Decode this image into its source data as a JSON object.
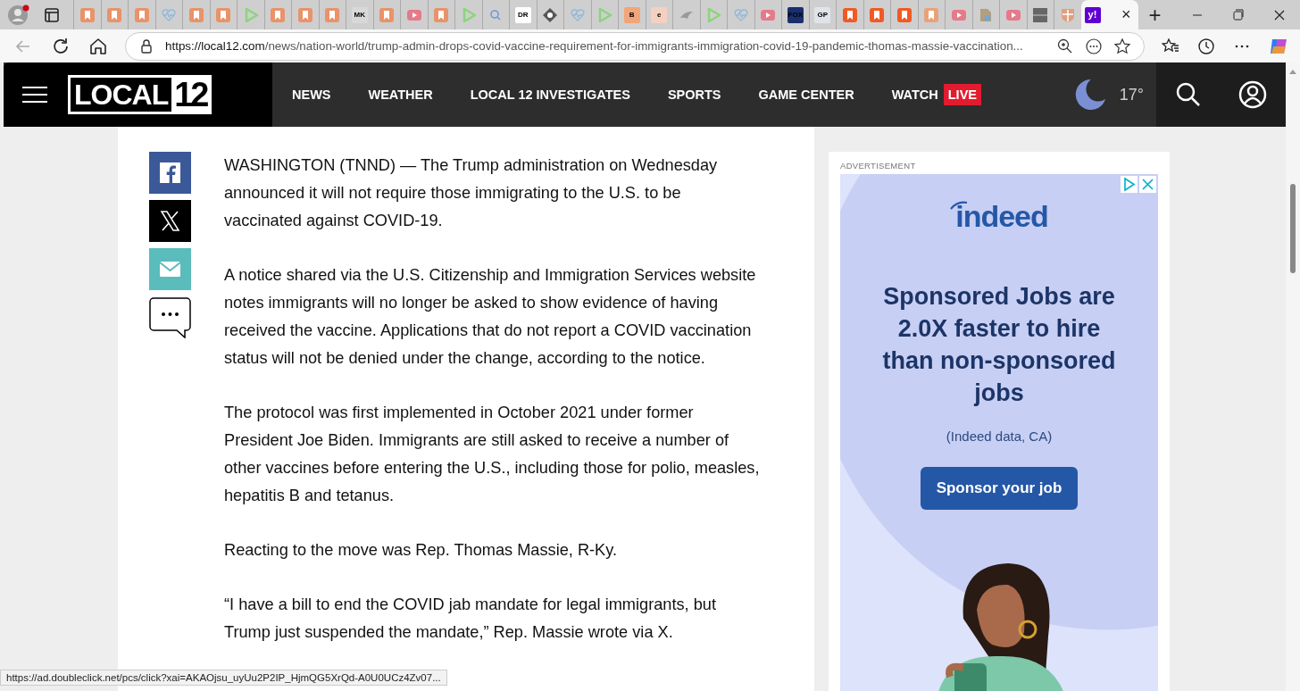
{
  "browser": {
    "tabs": [
      {
        "kind": "bookmark",
        "color": "#e8936a",
        "selected": false
      },
      {
        "kind": "bookmark",
        "color": "#e8936a",
        "selected": false
      },
      {
        "kind": "bookmark",
        "color": "#e8936a",
        "selected": false
      },
      {
        "kind": "pulse",
        "color": "#8fb8d8",
        "selected": false
      },
      {
        "kind": "bookmark",
        "color": "#e8936a",
        "selected": false
      },
      {
        "kind": "bookmark",
        "color": "#e8936a",
        "selected": false
      },
      {
        "kind": "play",
        "color": "#8cd47e",
        "selected": false
      },
      {
        "kind": "bookmark",
        "color": "#e8936a",
        "selected": false
      },
      {
        "kind": "bookmark",
        "color": "#e8936a",
        "selected": false
      },
      {
        "kind": "bookmark",
        "color": "#e8936a",
        "selected": false
      },
      {
        "kind": "text",
        "glyph": "MK",
        "color": "#d8d8d8",
        "selected": false
      },
      {
        "kind": "bookmark",
        "color": "#e8936a",
        "selected": false
      },
      {
        "kind": "youtube",
        "color": "#e57a8a",
        "selected": false
      },
      {
        "kind": "bookmark",
        "color": "#e8936a",
        "selected": false
      },
      {
        "kind": "play",
        "color": "#8cd47e",
        "selected": false
      },
      {
        "kind": "search",
        "color": "#6a9bd8",
        "selected": false
      },
      {
        "kind": "text",
        "glyph": "DR",
        "color": "#ffffff",
        "selected": false
      },
      {
        "kind": "diamond",
        "color": "#555555",
        "selected": false
      },
      {
        "kind": "pulse",
        "color": "#8fb8d8",
        "selected": false
      },
      {
        "kind": "play",
        "color": "#8cd47e",
        "selected": false
      },
      {
        "kind": "text",
        "glyph": "B",
        "color": "#f2a57a",
        "selected": false
      },
      {
        "kind": "text",
        "glyph": "e",
        "color": "#f5d0c0",
        "selected": false
      },
      {
        "kind": "bird",
        "color": "#999999",
        "selected": false
      },
      {
        "kind": "play",
        "color": "#8cd47e",
        "selected": false
      },
      {
        "kind": "pulse",
        "color": "#8fb8d8",
        "selected": false
      },
      {
        "kind": "youtube",
        "color": "#e57a8a",
        "selected": false
      },
      {
        "kind": "text",
        "glyph": "FOX",
        "color": "#1a2f6e",
        "selected": false
      },
      {
        "kind": "text",
        "glyph": "GP",
        "color": "#e0e4ea",
        "selected": false
      },
      {
        "kind": "bookmark",
        "color": "#f05a24",
        "selected": false
      },
      {
        "kind": "bookmark",
        "color": "#f05a24",
        "selected": false
      },
      {
        "kind": "bookmark",
        "color": "#f05a24",
        "selected": false
      },
      {
        "kind": "bookmark",
        "color": "#e8a27a",
        "selected": false
      },
      {
        "kind": "youtube",
        "color": "#e57a8a",
        "selected": false
      },
      {
        "kind": "doc",
        "color": "#b0a080",
        "selected": false
      },
      {
        "kind": "youtube",
        "color": "#e57a8a",
        "selected": false
      },
      {
        "kind": "grid",
        "color": "#666666",
        "selected": false
      },
      {
        "kind": "shield",
        "color": "#e0a080",
        "selected": false
      },
      {
        "kind": "text",
        "glyph": "y!",
        "color": "#6001d2",
        "selected": true
      }
    ],
    "close_tab": "×",
    "new_tab": "+",
    "url": {
      "host": "https://local12.com",
      "path": "/news/nation-world/trump-admin-drops-covid-vaccine-requirement-for-immigrants-immigration-covid-19-pandemic-thomas-massie-vaccination..."
    },
    "status_url": "https://ad.doubleclick.net/pcs/click?xai=AKAOjsu_uyUu2P2IP_HjmQG5XrQd-A0U0UCz4Zv07..."
  },
  "site": {
    "logo": {
      "word": "LOCAL",
      "number": "12"
    },
    "nav": [
      {
        "label": "NEWS"
      },
      {
        "label": "WEATHER"
      },
      {
        "label": "LOCAL 12 INVESTIGATES"
      },
      {
        "label": "SPORTS"
      },
      {
        "label": "GAME CENTER"
      },
      {
        "label": "WATCH",
        "badge": "LIVE"
      }
    ],
    "temperature": "17°"
  },
  "article": {
    "paragraphs": [
      "WASHINGTON (TNND) — The Trump administration on Wednesday announced it will not require those immigrating to the U.S. to be vaccinated against COVID-19.",
      "A notice shared via the U.S. Citizenship and Immigration Services website notes immigrants will no longer be asked to show evidence of having received the vaccine. Applications that do not report a COVID vaccination status will not be denied under the change, according to the notice.",
      "The protocol was first implemented in October 2021 under former President Joe Biden. Immigrants are still asked to receive a number of other vaccines before entering the U.S., including those for polio, measles, hepatitis B and tetanus.",
      "Reacting to the move was Rep. Thomas Massie, R-Ky.",
      "“I have a bill to end the COVID jab mandate for legal immigrants, but Trump just suspended the mandate,” Rep. Massie wrote via X."
    ],
    "share": [
      {
        "kind": "facebook"
      },
      {
        "kind": "x"
      },
      {
        "kind": "email"
      },
      {
        "kind": "comment"
      }
    ]
  },
  "ad": {
    "label": "ADVERTISEMENT",
    "brand": "indeed",
    "headline": "Sponsored Jobs are 2.0X faster to hire than non-sponsored jobs",
    "note": "(Indeed data, CA)",
    "button": "Sponsor your job"
  }
}
